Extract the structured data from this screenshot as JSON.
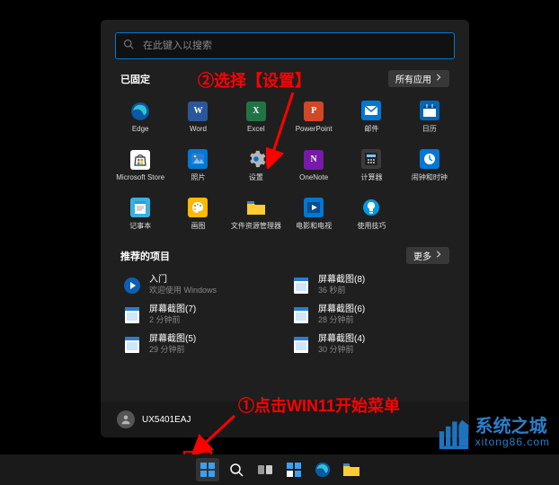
{
  "search": {
    "placeholder": "在此键入以搜索"
  },
  "pinned_section": {
    "title": "已固定",
    "all_apps": "所有应用"
  },
  "pinned": [
    {
      "name": "edge",
      "label": "Edge",
      "color": "#0c59a4",
      "letter": ""
    },
    {
      "name": "word",
      "label": "Word",
      "color": "#2b579a",
      "letter": "W"
    },
    {
      "name": "excel",
      "label": "Excel",
      "color": "#217346",
      "letter": "X"
    },
    {
      "name": "powerpoint",
      "label": "PowerPoint",
      "color": "#d24726",
      "letter": "P"
    },
    {
      "name": "mail",
      "label": "邮件",
      "color": "#0078d4",
      "letter": ""
    },
    {
      "name": "calendar",
      "label": "日历",
      "color": "#0067b8",
      "letter": ""
    },
    {
      "name": "ms-store",
      "label": "Microsoft Store",
      "color": "#ffffff",
      "letter": ""
    },
    {
      "name": "photos",
      "label": "照片",
      "color": "#0078d4",
      "letter": ""
    },
    {
      "name": "settings",
      "label": "设置",
      "color": "#5a5a5a",
      "letter": ""
    },
    {
      "name": "onenote",
      "label": "OneNote",
      "color": "#7719aa",
      "letter": "N"
    },
    {
      "name": "calculator",
      "label": "计算器",
      "color": "#3b3b3b",
      "letter": ""
    },
    {
      "name": "clock",
      "label": "闹钟和时钟",
      "color": "#0078d4",
      "letter": ""
    },
    {
      "name": "notepad",
      "label": "记事本",
      "color": "#3ab0e1",
      "letter": ""
    },
    {
      "name": "paint",
      "label": "画图",
      "color": "#ffb900",
      "letter": ""
    },
    {
      "name": "explorer",
      "label": "文件资源管理器",
      "color": "#ffcc33",
      "letter": ""
    },
    {
      "name": "movies-tv",
      "label": "电影和电视",
      "color": "#0078d4",
      "letter": ""
    },
    {
      "name": "tips",
      "label": "使用技巧",
      "color": "#0099e5",
      "letter": ""
    }
  ],
  "recommended_section": {
    "title": "推荐的项目",
    "more": "更多"
  },
  "recommended": [
    {
      "name": "get-started",
      "title": "入门",
      "sub": "欢迎使用 Windows"
    },
    {
      "name": "shot8",
      "title": "屏幕截图(8)",
      "sub": "36 秒前"
    },
    {
      "name": "shot7",
      "title": "屏幕截图(7)",
      "sub": "2 分钟前"
    },
    {
      "name": "shot6",
      "title": "屏幕截图(6)",
      "sub": "28 分钟前"
    },
    {
      "name": "shot5",
      "title": "屏幕截图(5)",
      "sub": "29 分钟前"
    },
    {
      "name": "shot4",
      "title": "屏幕截图(4)",
      "sub": "30 分钟前"
    }
  ],
  "user": {
    "name": "UX5401EAJ"
  },
  "annotations": {
    "step1": "①点击WIN11开始菜单",
    "step2": "②选择【设置】"
  },
  "watermark": {
    "line1": "系统之城",
    "line2": "xitong86.com"
  }
}
